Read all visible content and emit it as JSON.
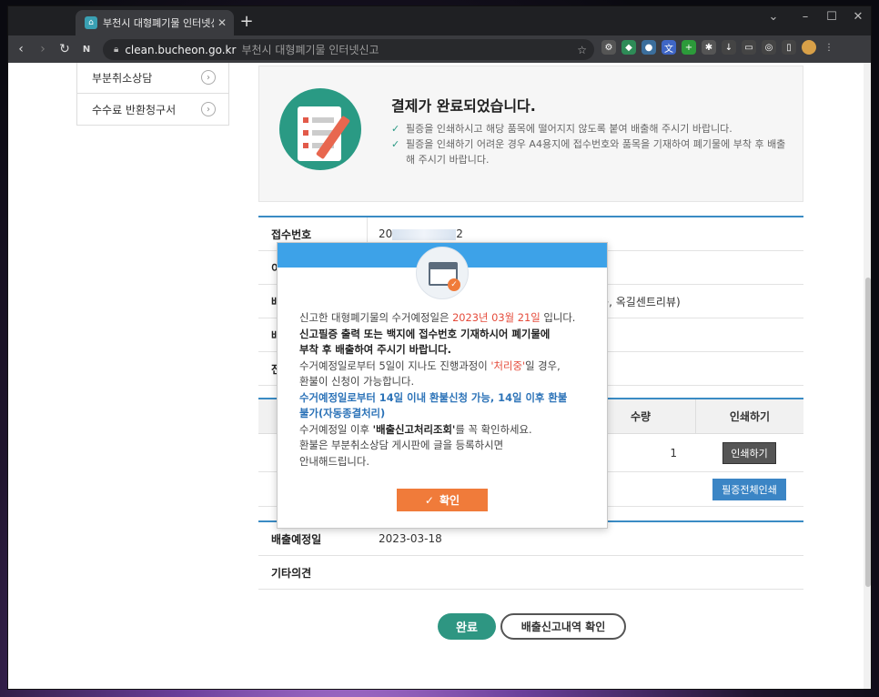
{
  "browser": {
    "tab_title": "부천시 대형폐기물 인터넷신고",
    "url_host": "clean.bucheon.go.kr",
    "url_title": "부천시 대형폐기물 인터넷신고"
  },
  "sidebar": {
    "items": [
      "부분취소상담",
      "수수료 반환청구서"
    ]
  },
  "completion": {
    "title": "결제가 완료되었습니다.",
    "notes": [
      "필증을 인쇄하시고 해당 품목에 떨어지지 않도록 붙여 배출해 주시기 바랍니다.",
      "필증을 인쇄하기 어려운 경우 A4용지에 접수번호와 품목을 기재하여 폐기물에 부착 후 배출해 주시기 바랍니다."
    ]
  },
  "info": {
    "receipt_label": "접수번호",
    "receipt_prefix": "20",
    "receipt_suffix": "2",
    "rows": [
      "이",
      "배",
      "배",
      "전"
    ],
    "address_tail": "옥길동, 옥길센트리뷰)"
  },
  "items": {
    "col_qty": "수량",
    "col_print": "인쇄하기",
    "qty": "1",
    "print_btn": "인쇄하기",
    "print_all_btn": "필증전체인쇄"
  },
  "disposal": {
    "date_label": "배출예정일",
    "date_value": "2023-03-18",
    "comment_label": "기타의견"
  },
  "actions": {
    "complete": "완료",
    "history": "배출신고내역 확인"
  },
  "modal": {
    "l1a": "신고한 대형폐기물의 수거예정일은 ",
    "date": "2023년 03월 21일",
    "l1b": " 입니다.",
    "l2": "신고필증 출력 또는 백지에 접수번호 기재하시어 폐기물에",
    "l3": "부착 후 배출하여 주시기 바랍니다.",
    "l4a": "수거예정일로부터 5일이 지나도 진행과정이 ",
    "l4red": "'처리중'",
    "l4b": "일 경우,",
    "l5": "환불이 신청이 가능합니다.",
    "l6": "수거예정일로부터 14일 이내 환불신청 가능, 14일 이후 환불",
    "l7": "불가(자동종결처리)",
    "l8a": "수거예정일 이후 ",
    "l8b": "'배출신고처리조회'",
    "l8c": "를 꼭 확인하세요.",
    "l9": "환불은 부분취소상담 게시판에 글을 등록하시면",
    "l10": "안내해드립니다.",
    "confirm": "확인"
  }
}
